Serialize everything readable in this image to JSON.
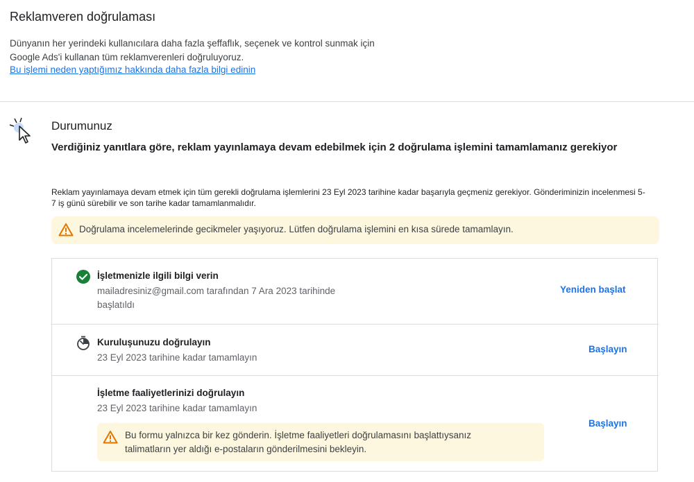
{
  "header": {
    "title": "Reklamveren doğrulaması",
    "description_line1": "Dünyanın her yerindeki kullanıcılara daha fazla şeffaflık, seçenek ve kontrol sunmak için",
    "description_line2": "Google Ads'i kullanan tüm reklamverenleri doğruluyoruz.",
    "learn_more_link": "Bu işlemi neden yaptığımız hakkında daha fazla bilgi edinin"
  },
  "status": {
    "title": "Durumunuz",
    "subtitle": "Verdiğiniz yanıtlara göre, reklam yayınlamaya devam edebilmek için 2 doğrulama işlemini tamamlamanız gerekiyor",
    "notice": "Reklam yayınlamaya devam etmek için tüm gerekli doğrulama işlemlerini 23 Eyl 2023 tarihine kadar başarıyla geçmeniz gerekiyor. Gönderiminizin incelenmesi 5-7 iş günü sürebilir ve son tarihe kadar tamamlanmalıdır.",
    "warning": "Doğrulama incelemelerinde gecikmeler yaşıyoruz. Lütfen doğrulama işlemini en kısa sürede tamamlayın."
  },
  "steps": [
    {
      "title": "İşletmenizle ilgili bilgi verin",
      "subtitle_line1": "mailadresiniz@gmail.com tarafından 7 Ara 2023 tarihinde",
      "subtitle_line2": "başlatıldı",
      "action": "Yeniden başlat",
      "state_icon": "check-circle-icon"
    },
    {
      "title": "Kuruluşunuzu doğrulayın",
      "subtitle": "23 Eyl 2023 tarihine kadar tamamlayın",
      "action": "Başlayın",
      "state_icon": "timer-icon"
    },
    {
      "title": "İşletme faaliyetlerinizi doğrulayın",
      "subtitle": "23 Eyl 2023 tarihine kadar tamamlayın",
      "action": "Başlayın",
      "warning_line1": "Bu formu yalnızca bir kez gönderin. İşletme faaliyetleri doğrulamasını başlattıysanız",
      "warning_line2": "talimatların yer aldığı e-postaların gönderilmesini bekleyin."
    }
  ],
  "colors": {
    "accent": "#1a73e8",
    "success": "#188038",
    "warning_bg": "#fef7e0",
    "warning_icon": "#e37400"
  }
}
